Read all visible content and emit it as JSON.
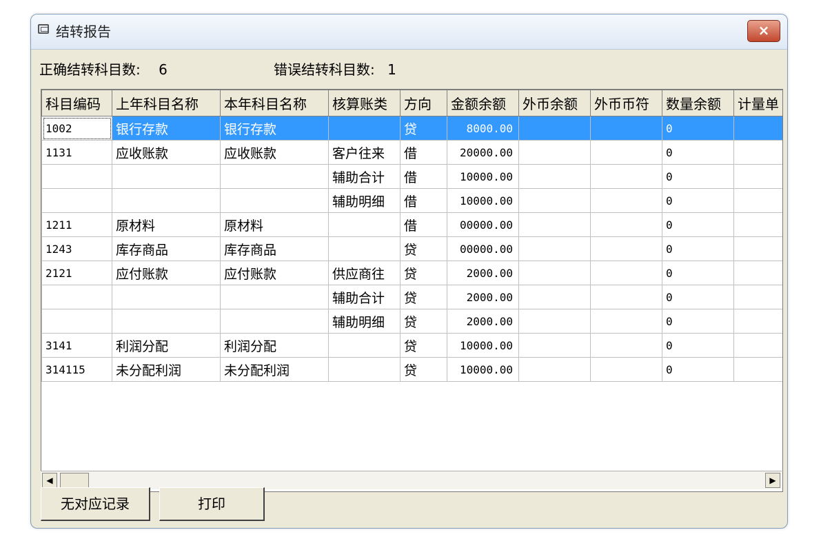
{
  "window": {
    "title": "结转报告",
    "close_glyph": "×"
  },
  "summary": {
    "correct_label": "正确结转科目数:",
    "correct_value": "6",
    "error_label": "错误结转科目数:",
    "error_value": "1"
  },
  "table": {
    "columns": [
      "科目编码",
      "上年科目名称",
      "本年科目名称",
      "核算账类",
      "方向",
      "金额余额",
      "外币余额",
      "外币币符",
      "数量余额",
      "计量单"
    ],
    "rows": [
      [
        "1002",
        "银行存款",
        "银行存款",
        "",
        "贷",
        "8000.00",
        "",
        "",
        "0",
        ""
      ],
      [
        "1131",
        "应收账款",
        "应收账款",
        "客户往来",
        "借",
        "20000.00",
        "",
        "",
        "0",
        ""
      ],
      [
        "",
        "",
        "",
        "辅助合计",
        "借",
        "10000.00",
        "",
        "",
        "0",
        ""
      ],
      [
        "",
        "",
        "",
        "辅助明细",
        "借",
        "10000.00",
        "",
        "",
        "0",
        ""
      ],
      [
        "1211",
        "原材料",
        "原材料",
        "",
        "借",
        "00000.00",
        "",
        "",
        "0",
        ""
      ],
      [
        "1243",
        "库存商品",
        "库存商品",
        "",
        "贷",
        "00000.00",
        "",
        "",
        "0",
        ""
      ],
      [
        "2121",
        "应付账款",
        "应付账款",
        "供应商往",
        "贷",
        "2000.00",
        "",
        "",
        "0",
        ""
      ],
      [
        "",
        "",
        "",
        "辅助合计",
        "贷",
        "2000.00",
        "",
        "",
        "0",
        ""
      ],
      [
        "",
        "",
        "",
        "辅助明细",
        "贷",
        "2000.00",
        "",
        "",
        "0",
        ""
      ],
      [
        "3141",
        "利润分配",
        "利润分配",
        "",
        "贷",
        "10000.00",
        "",
        "",
        "0",
        ""
      ],
      [
        "314115",
        "未分配利润",
        "未分配利润",
        "",
        "贷",
        "10000.00",
        "",
        "",
        "0",
        ""
      ]
    ],
    "selected_row": 0
  },
  "scrollbar": {
    "left_arrow": "◀",
    "right_arrow": "▶"
  },
  "buttons": {
    "no_match": "无对应记录",
    "print": "打印"
  }
}
